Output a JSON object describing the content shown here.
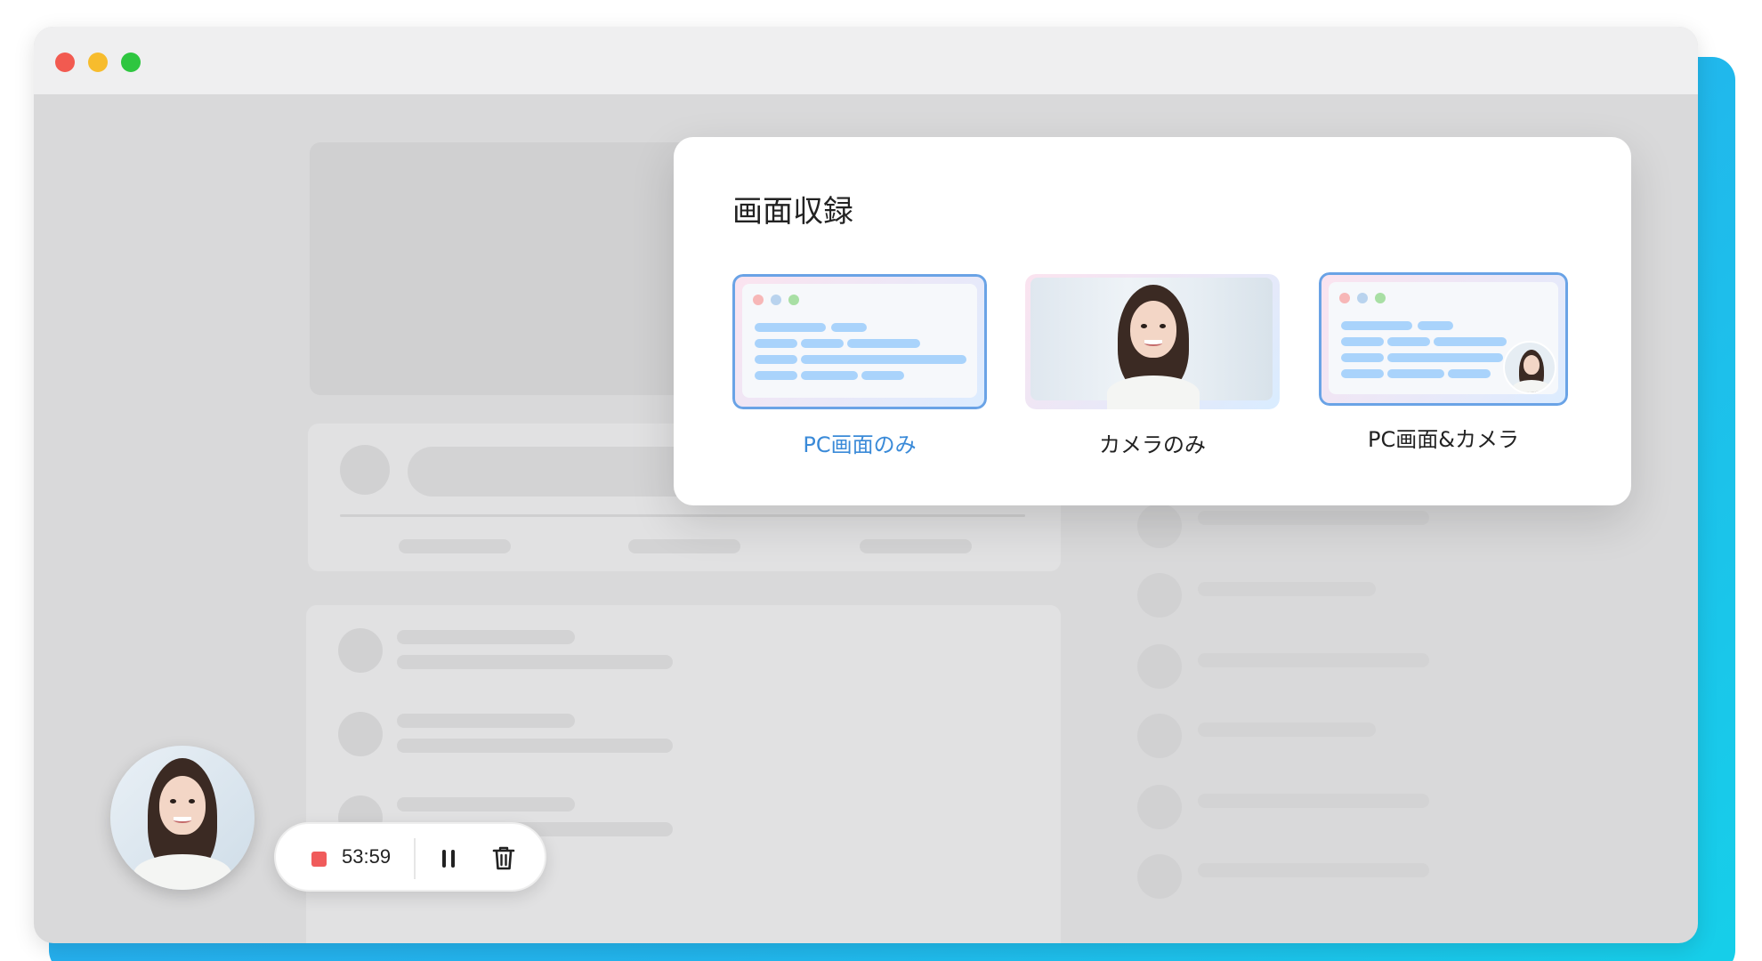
{
  "window": {
    "controls": [
      "close-dot",
      "minimize-dot",
      "maximize-dot"
    ]
  },
  "modal": {
    "title": "画面収録",
    "options": [
      {
        "label": "PC画面のみ",
        "selected": true
      },
      {
        "label": "カメラのみ",
        "selected": false
      },
      {
        "label": "PC画面&カメラ",
        "selected": false
      }
    ]
  },
  "recorder": {
    "time": "53:59",
    "icons": [
      "record-icon",
      "pause-icon",
      "trash-icon"
    ]
  },
  "colors": {
    "accent": "#3a8ad8",
    "record": "#f05b5b",
    "frame_gradient_start": "#2aa7ef",
    "frame_gradient_end": "#16cfe9"
  }
}
